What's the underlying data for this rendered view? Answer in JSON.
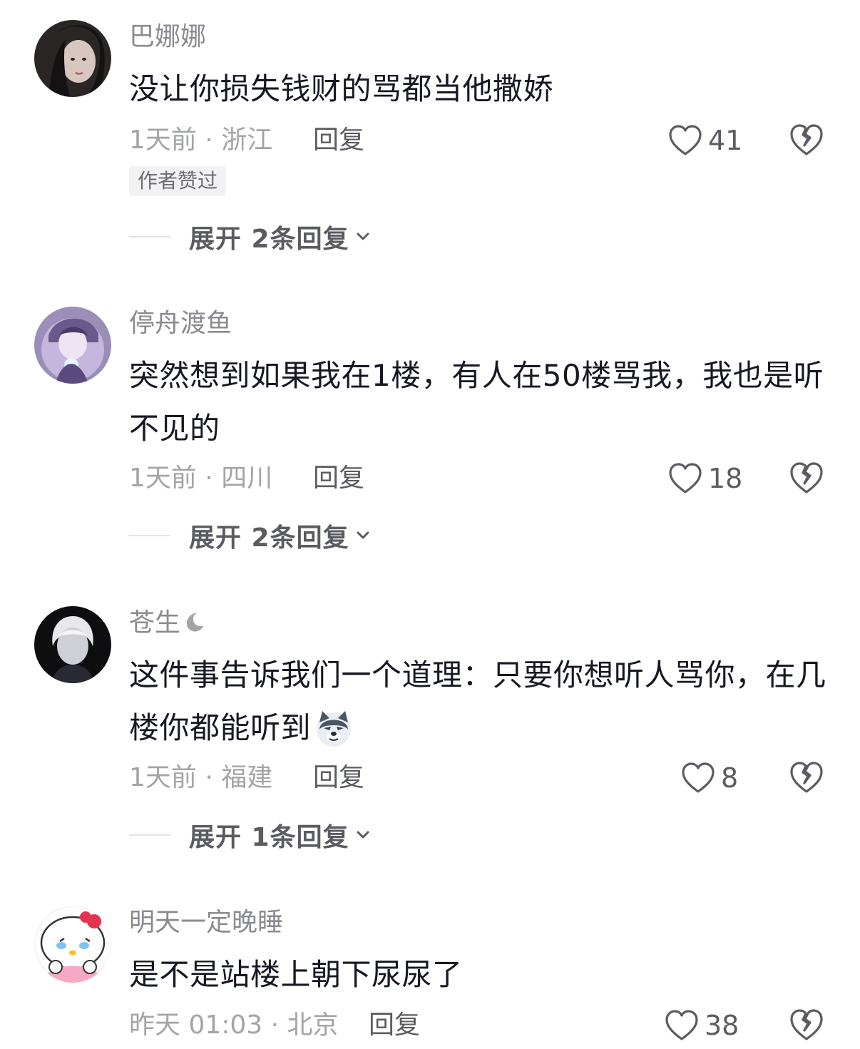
{
  "comments": [
    {
      "username": "巴娜娜",
      "text": "没让你损失钱财的骂都当他撒娇",
      "time_location": "1天前 · 浙江",
      "reply_label": "回复",
      "likes": "41",
      "badge": "作者赞过",
      "expand_label": "展开 2条回复"
    },
    {
      "username": "停舟渡鱼",
      "text": "突然想到如果我在1楼，有人在50楼骂我，我也是听不见的",
      "time_location": "1天前 · 四川",
      "reply_label": "回复",
      "likes": "18",
      "expand_label": "展开 2条回复"
    },
    {
      "username": "苍生",
      "text": "这件事告诉我们一个道理：只要你想听人骂你，在几楼你都能听到",
      "emoji": "wolf-emoji",
      "time_location": "1天前 · 福建",
      "reply_label": "回复",
      "likes": "8",
      "expand_label": "展开 1条回复"
    },
    {
      "username": "明天一定晚睡",
      "text": "是不是站楼上朝下尿尿了",
      "time_location": "昨天 01:03 · 北京",
      "reply_label": "回复",
      "likes": "38"
    }
  ],
  "icons": {
    "like": "heart-outline-icon",
    "dislike": "broken-heart-icon",
    "expand": "chevron-down-icon",
    "moon": "moon-icon"
  },
  "colors": {
    "text_primary": "#161823",
    "text_secondary": "#8a8b91",
    "action": "#5b5c62"
  }
}
